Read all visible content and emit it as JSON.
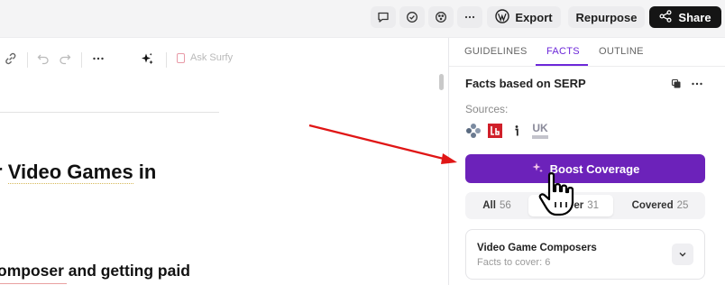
{
  "topbar": {
    "icons": [
      "comment-icon",
      "check-circle-icon",
      "graph-icon",
      "more-icon"
    ],
    "export_label": "Export",
    "repurpose_label": "Repurpose",
    "share_label": "Share"
  },
  "editor": {
    "toolbar": {
      "icons": [
        "link-icon",
        "undo-icon",
        "redo-icon",
        "more-icon",
        "sparkle-icon"
      ],
      "ask_label": "Ask Surfy"
    },
    "heading_prefix": "r ",
    "heading_highlight": "Video Games",
    "heading_suffix": " in",
    "subheading": "omposer and getting paid"
  },
  "panel": {
    "tabs": [
      {
        "label": "GUIDELINES",
        "active": false
      },
      {
        "label": "FACTS",
        "active": true
      },
      {
        "label": "OUTLINE",
        "active": false
      }
    ],
    "title": "Facts based on SERP",
    "sources_label": "Sources:",
    "sources": [
      "playstation-icon",
      "lb-icon",
      "i-icon",
      "uk-icon"
    ],
    "uk_text": "UK",
    "boost_label": "Boost Coverage",
    "filters": [
      {
        "label": "All",
        "count": "56",
        "active": false
      },
      {
        "label": "ver",
        "count": "31",
        "active": true
      },
      {
        "label": "Covered",
        "count": "25",
        "active": false
      }
    ],
    "card": {
      "title": "Video Game Composers",
      "subtitle": "Facts to cover: 6"
    }
  },
  "colors": {
    "accent": "#6c22ba",
    "arrow": "#e01616",
    "share_bg": "#151515"
  }
}
